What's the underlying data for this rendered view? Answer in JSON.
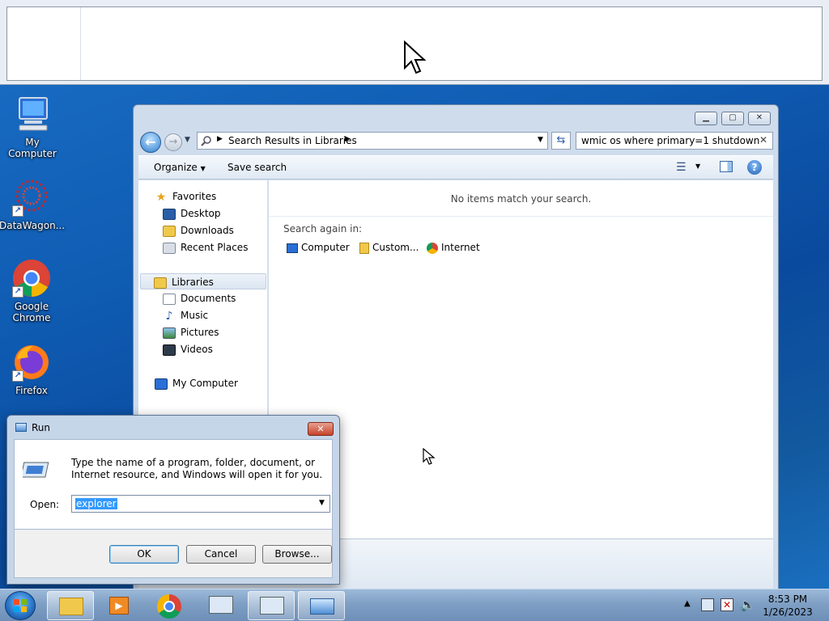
{
  "desktop": {
    "icons": [
      {
        "label": "My Computer"
      },
      {
        "label": "DataWagon..."
      },
      {
        "label": "Google Chrome"
      },
      {
        "label": "Firefox"
      }
    ]
  },
  "explorer": {
    "address": "Search Results in Libraries",
    "search_value": "wmic os where primary=1 shutdown",
    "toolbar": {
      "organize": "Organize",
      "save_search": "Save search"
    },
    "nav": {
      "favorites": "Favorites",
      "desktop": "Desktop",
      "downloads": "Downloads",
      "recent": "Recent Places",
      "libraries": "Libraries",
      "documents": "Documents",
      "music": "Music",
      "pictures": "Pictures",
      "videos": "Videos",
      "my_computer": "My Computer"
    },
    "content": {
      "empty_message": "No items match your search.",
      "search_again": "Search again in:",
      "locations": [
        "Computer",
        "Custom...",
        "Internet"
      ]
    }
  },
  "run": {
    "title": "Run",
    "description": "Type the name of a program, folder, document, or Internet resource, and Windows will open it for you.",
    "open_label": "Open:",
    "open_value": "explorer",
    "ok": "OK",
    "cancel": "Cancel",
    "browse": "Browse..."
  },
  "taskbar": {
    "time": "8:53 PM",
    "date": "1/26/2023"
  }
}
